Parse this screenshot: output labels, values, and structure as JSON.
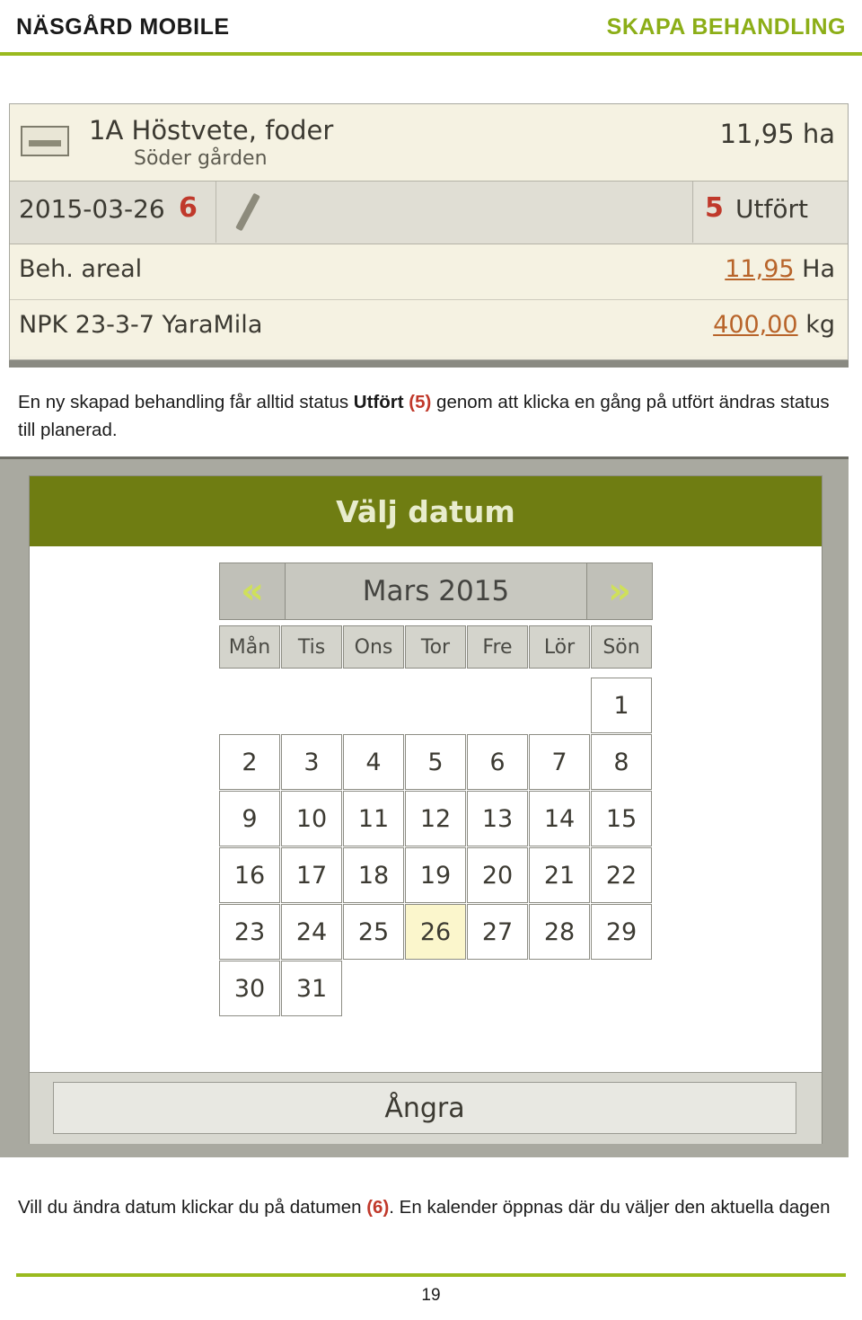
{
  "header": {
    "left_title": "NÄSGÅRD MOBILE",
    "right_title": "SKAPA BEHANDLING"
  },
  "treatment_card": {
    "crop_icon": "field-icon",
    "field_name": "1A Höstvete, foder",
    "farm_name": "Söder gården",
    "field_area": "11,95 ha",
    "date": "2015-03-26",
    "date_callout": "6",
    "edit_icon": "pencil-icon",
    "status_callout": "5",
    "status_label": "Utfört",
    "rows": [
      {
        "label": "Beh. areal",
        "value_num": "11,95",
        "value_unit": "Ha"
      },
      {
        "label": "NPK 23-3-7 YaraMila",
        "value_num": "400,00",
        "value_unit": "kg"
      }
    ]
  },
  "caption1": {
    "part1": "En ny skapad behandling får alltid status ",
    "bold": "Utfört",
    "callout": "(5)",
    "part2": " genom att klicka en gång på utfört ändras status till planerad."
  },
  "calendar": {
    "title": "Välj datum",
    "prev_label": "«",
    "next_label": "»",
    "month_label": "Mars 2015",
    "weekdays": [
      "Mån",
      "Tis",
      "Ons",
      "Tor",
      "Fre",
      "Lör",
      "Sön"
    ],
    "weeks": [
      [
        "",
        "",
        "",
        "",
        "",
        "",
        "1"
      ],
      [
        "2",
        "3",
        "4",
        "5",
        "6",
        "7",
        "8"
      ],
      [
        "9",
        "10",
        "11",
        "12",
        "13",
        "14",
        "15"
      ],
      [
        "16",
        "17",
        "18",
        "19",
        "20",
        "21",
        "22"
      ],
      [
        "23",
        "24",
        "25",
        "26",
        "27",
        "28",
        "29"
      ],
      [
        "30",
        "31",
        "",
        "",
        "",
        "",
        ""
      ]
    ],
    "selected_day": "26",
    "cancel_label": "Ångra"
  },
  "caption2": {
    "part1": "Vill du ändra datum klickar du på datumen ",
    "callout": "(6)",
    "part2": ". En kalender öppnas där du väljer den aktuella dagen"
  },
  "footer": {
    "page_number": "19"
  },
  "colors": {
    "accent_green": "#9aba1e",
    "header_right": "#8cae17",
    "callout_red": "#c0392b",
    "calendar_title_bg": "#6f7d12",
    "selected_day_bg": "#fbf6cc"
  }
}
